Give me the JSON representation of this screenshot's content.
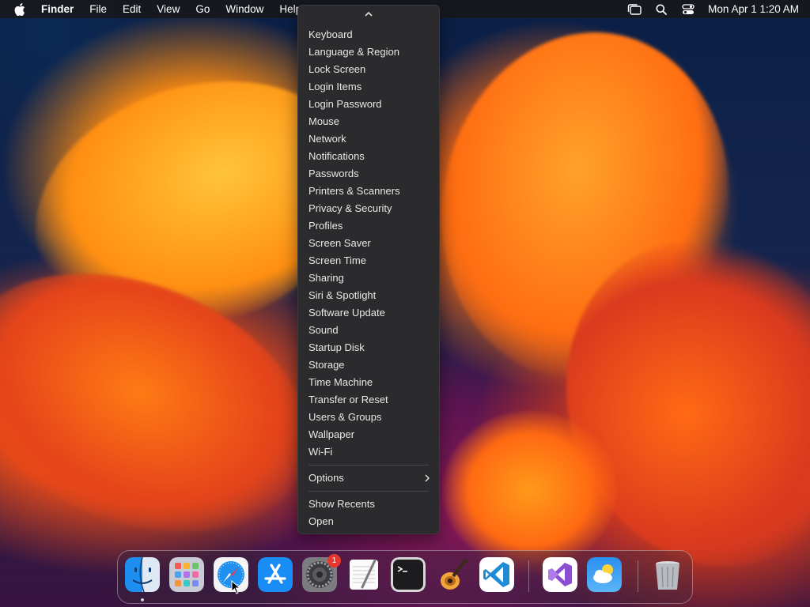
{
  "menubar": {
    "app_name": "Finder",
    "menus": [
      "File",
      "Edit",
      "View",
      "Go",
      "Window",
      "Help"
    ],
    "clock": "Mon Apr 1  1:20 AM"
  },
  "dropdown": {
    "items": [
      "Keyboard",
      "Language & Region",
      "Lock Screen",
      "Login Items",
      "Login Password",
      "Mouse",
      "Network",
      "Notifications",
      "Passwords",
      "Printers & Scanners",
      "Privacy & Security",
      "Profiles",
      "Screen Saver",
      "Screen Time",
      "Sharing",
      "Siri & Spotlight",
      "Software Update",
      "Sound",
      "Startup Disk",
      "Storage",
      "Time Machine",
      "Transfer or Reset",
      "Users & Groups",
      "Wallpaper",
      "Wi-Fi"
    ],
    "options_label": "Options",
    "recent_items": [
      "Show Recents",
      "Open"
    ]
  },
  "dock": {
    "apps": [
      "Finder",
      "Launchpad",
      "Safari",
      "App Store",
      "System Settings",
      "TextEdit",
      "Terminal",
      "GarageBand",
      "Visual Studio Code",
      "Visual Studio",
      "Weather",
      "Trash"
    ],
    "system_settings_badge": "1"
  },
  "colors": {
    "menu_bg": "#2b2b2d",
    "menubar_bg": "#18181c",
    "badge": "#e6362e"
  }
}
